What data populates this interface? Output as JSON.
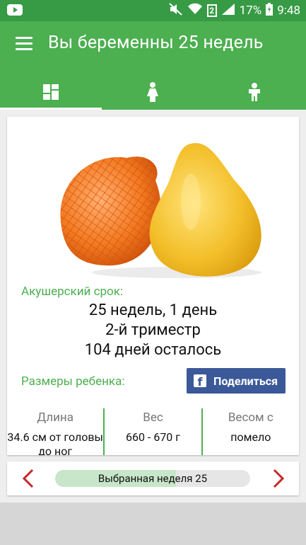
{
  "status": {
    "battery": "17%",
    "time": "9:48",
    "sim": "2"
  },
  "app": {
    "title": "Вы беременны 25 недель"
  },
  "tabs": [
    {
      "icon": "dashboard-icon",
      "active": true
    },
    {
      "icon": "mother-icon",
      "active": false
    },
    {
      "icon": "baby-icon",
      "active": false
    }
  ],
  "card": {
    "fruit_image": "pomelo",
    "obstetric_label": "Акушерский срок:",
    "term_line1": "25 недель, 1 день",
    "term_line2": "2-й триместр",
    "term_line3": "104 дней осталось",
    "baby_size_label": "Размеры ребенка:",
    "share_label": "Поделиться",
    "columns": [
      {
        "header": "Длина",
        "value": "34.6 см от головы до ног"
      },
      {
        "header": "Вес",
        "value": "660 - 670 г"
      },
      {
        "header": "Весом с",
        "value": "помело"
      }
    ]
  },
  "week_selector": {
    "label": "Выбранная неделя 25",
    "progress": 0.62
  },
  "colors": {
    "primary": "#4caf50",
    "statusbar": "#379b45",
    "facebook": "#3b5998",
    "arrow": "#c62828"
  }
}
